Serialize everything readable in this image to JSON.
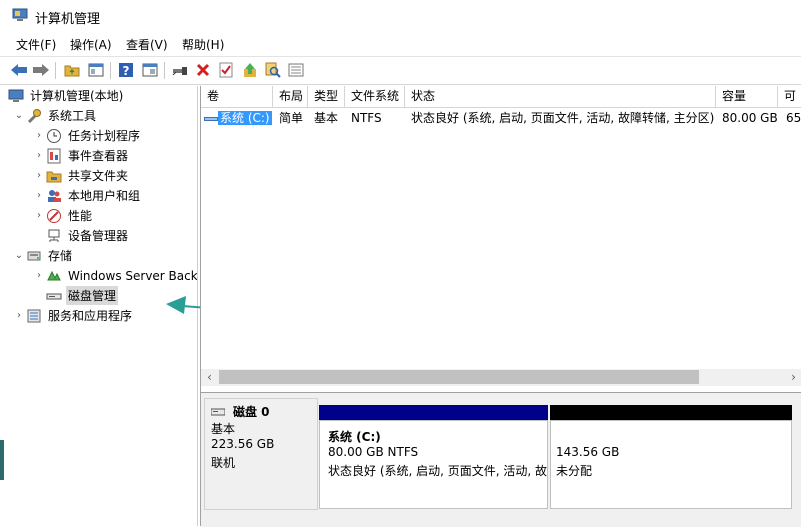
{
  "window": {
    "title": "计算机管理"
  },
  "menu": [
    "文件(F)",
    "操作(A)",
    "查看(V)",
    "帮助(H)"
  ],
  "tree": {
    "root": "计算机管理(本地)",
    "system_tools": "系统工具",
    "task_scheduler": "任务计划程序",
    "event_viewer": "事件查看器",
    "shared_folders": "共享文件夹",
    "local_users": "本地用户和组",
    "performance": "性能",
    "device_manager": "设备管理器",
    "storage": "存储",
    "wsb": "Windows Server Back",
    "disk_mgmt": "磁盘管理",
    "services_apps": "服务和应用程序"
  },
  "volumes": {
    "headers": [
      "卷",
      "布局",
      "类型",
      "文件系统",
      "状态",
      "容量",
      "可"
    ],
    "rows": [
      {
        "name": "系统 (C:)",
        "layout": "简单",
        "type": "基本",
        "fs": "NTFS",
        "status": "状态良好 (系统, 启动, 页面文件, 活动, 故障转储, 主分区)",
        "capacity": "80.00 GB",
        "free": "65"
      }
    ]
  },
  "disk0": {
    "name": "磁盘 0",
    "type": "基本",
    "size": "223.56 GB",
    "state": "联机",
    "partitions": [
      {
        "name": "系统  (C:)",
        "detail": "80.00 GB NTFS",
        "status": "状态良好 (系统, 启动, 页面文件, 活动, 故"
      },
      {
        "size": "143.56 GB",
        "label": "未分配"
      }
    ]
  },
  "colors": {
    "primary_bar": "#00008b",
    "unallocated_bar": "#000000",
    "arrow": "#2a9d95",
    "selection": "#3399ff"
  }
}
